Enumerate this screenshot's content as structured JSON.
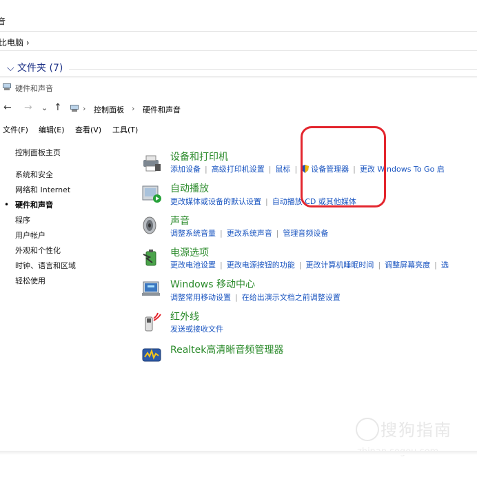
{
  "background": {
    "title_fragment": "音",
    "address_fragment": "比电脑  ›",
    "folder_group": "⌵ 文件夹 (7)"
  },
  "window": {
    "title": "硬件和声音",
    "nav": {
      "back": "←",
      "forward": "→",
      "dropdown": "⌄",
      "up": "↑"
    },
    "breadcrumb": [
      "控制面板",
      "硬件和声音"
    ],
    "breadcrumb_sep": "›",
    "menu": [
      "文件(F)",
      "编辑(E)",
      "查看(V)",
      "工具(T)"
    ]
  },
  "left_nav": {
    "items": [
      "控制面板主页",
      "系统和安全",
      "网络和 Internet",
      "硬件和声音",
      "程序",
      "用户帐户",
      "外观和个性化",
      "时钟、语言和区域",
      "轻松使用"
    ],
    "active_index": 3
  },
  "categories": [
    {
      "title": "设备和打印机",
      "links": [
        "添加设备",
        "高级打印机设置",
        "鼠标",
        "设备管理器",
        "更改 Windows To Go 启"
      ]
    },
    {
      "title": "自动播放",
      "links": [
        "更改媒体或设备的默认设置",
        "自动播放 CD 或其他媒体"
      ]
    },
    {
      "title": "声音",
      "links": [
        "调整系统音量",
        "更改系统声音",
        "管理音频设备"
      ]
    },
    {
      "title": "电源选项",
      "links": [
        "更改电池设置",
        "更改电源按钮的功能",
        "更改计算机睡眠时间",
        "调整屏幕亮度",
        "选"
      ]
    },
    {
      "title": "Windows 移动中心",
      "links": [
        "调整常用移动设置",
        "在给出演示文档之前调整设置"
      ]
    },
    {
      "title": "红外线",
      "links": [
        "发送或接收文件"
      ]
    },
    {
      "title": "Realtek高清晰音频管理器",
      "links": []
    }
  ],
  "watermark": {
    "brand": "搜狗指南",
    "url": "zhinan.sogou.com"
  },
  "colors": {
    "category_title": "#2a8a2a",
    "link": "#1a55c0",
    "highlight": "#e3262e"
  }
}
